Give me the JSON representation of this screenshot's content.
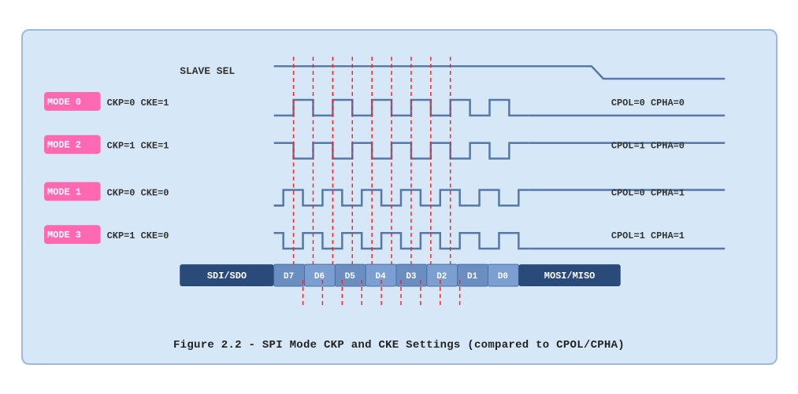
{
  "caption": "Figure 2.2 - SPI Mode CKP and CKE Settings (compared to CPOL/CPHA)",
  "diagram": {
    "slave_sel": "SLAVE SEL",
    "mode0": {
      "label": "MODE 0",
      "params": "CKP=0  CKE=1",
      "right": "CPOL=0  CPHA=0"
    },
    "mode2": {
      "label": "MODE 2",
      "params": "CKP=1  CKE=1",
      "right": "CPOL=1  CPHA=0"
    },
    "mode1": {
      "label": "MODE 1",
      "params": "CKP=0  CKE=0",
      "right": "CPOL=0  CPHA=1"
    },
    "mode3": {
      "label": "MODE 3",
      "params": "CKP=1  CKE=0",
      "right": "CPOL=1  CPHA=1"
    },
    "data_labels": [
      "SDI/SDO",
      "D7",
      "D6",
      "D5",
      "D4",
      "D3",
      "D2",
      "D1",
      "D0",
      "MOSI/MISO"
    ]
  }
}
